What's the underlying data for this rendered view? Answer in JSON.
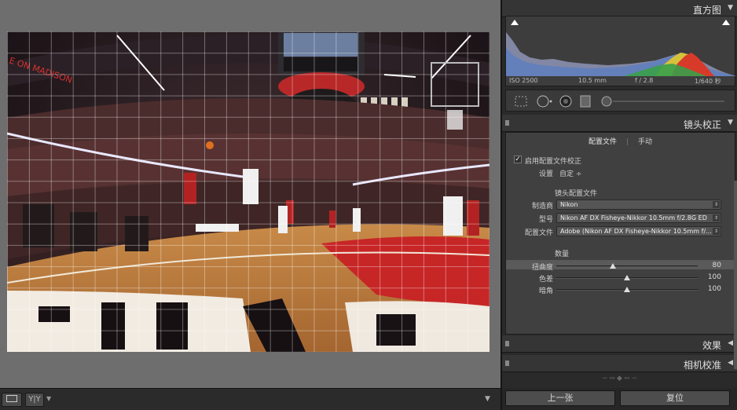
{
  "histogram": {
    "title": "直方图",
    "iso": "ISO 2500",
    "focal": "10.5 mm",
    "aperture": "f / 2.8",
    "shutter": "1/640 秒"
  },
  "lens": {
    "title": "镜头校正",
    "tabs": {
      "profile": "配置文件",
      "manual": "手动"
    },
    "enable_label": "启用配置文件校正",
    "enable_check": "✓",
    "setup_label": "设置",
    "setup_value": "自定 ÷",
    "profile_heading": "镜头配置文件",
    "make_label": "制造商",
    "make_value": "Nikon",
    "model_label": "型号",
    "model_value": "Nikon AF DX Fisheye-Nikkor 10.5mm f/2.8G ED",
    "profile_label": "配置文件",
    "profile_value": "Adobe (Nikon AF DX Fisheye-Nikkor 10.5mm f/...",
    "amount_heading": "数量",
    "sliders": [
      {
        "label": "扭曲度",
        "value": "80",
        "fraction": 0.4
      },
      {
        "label": "色差",
        "value": "100",
        "fraction": 0.5
      },
      {
        "label": "暗角",
        "value": "100",
        "fraction": 0.5
      }
    ]
  },
  "effects": {
    "title": "效果"
  },
  "camera_calibration": {
    "title": "相机校准"
  },
  "footer": {
    "prev": "上一张",
    "reset": "复位"
  },
  "toolbar": {
    "yy": "Y|Y"
  },
  "colors": {
    "panel": "#2a2a2a",
    "section": "#404040",
    "stage": "#6e6e6e"
  }
}
